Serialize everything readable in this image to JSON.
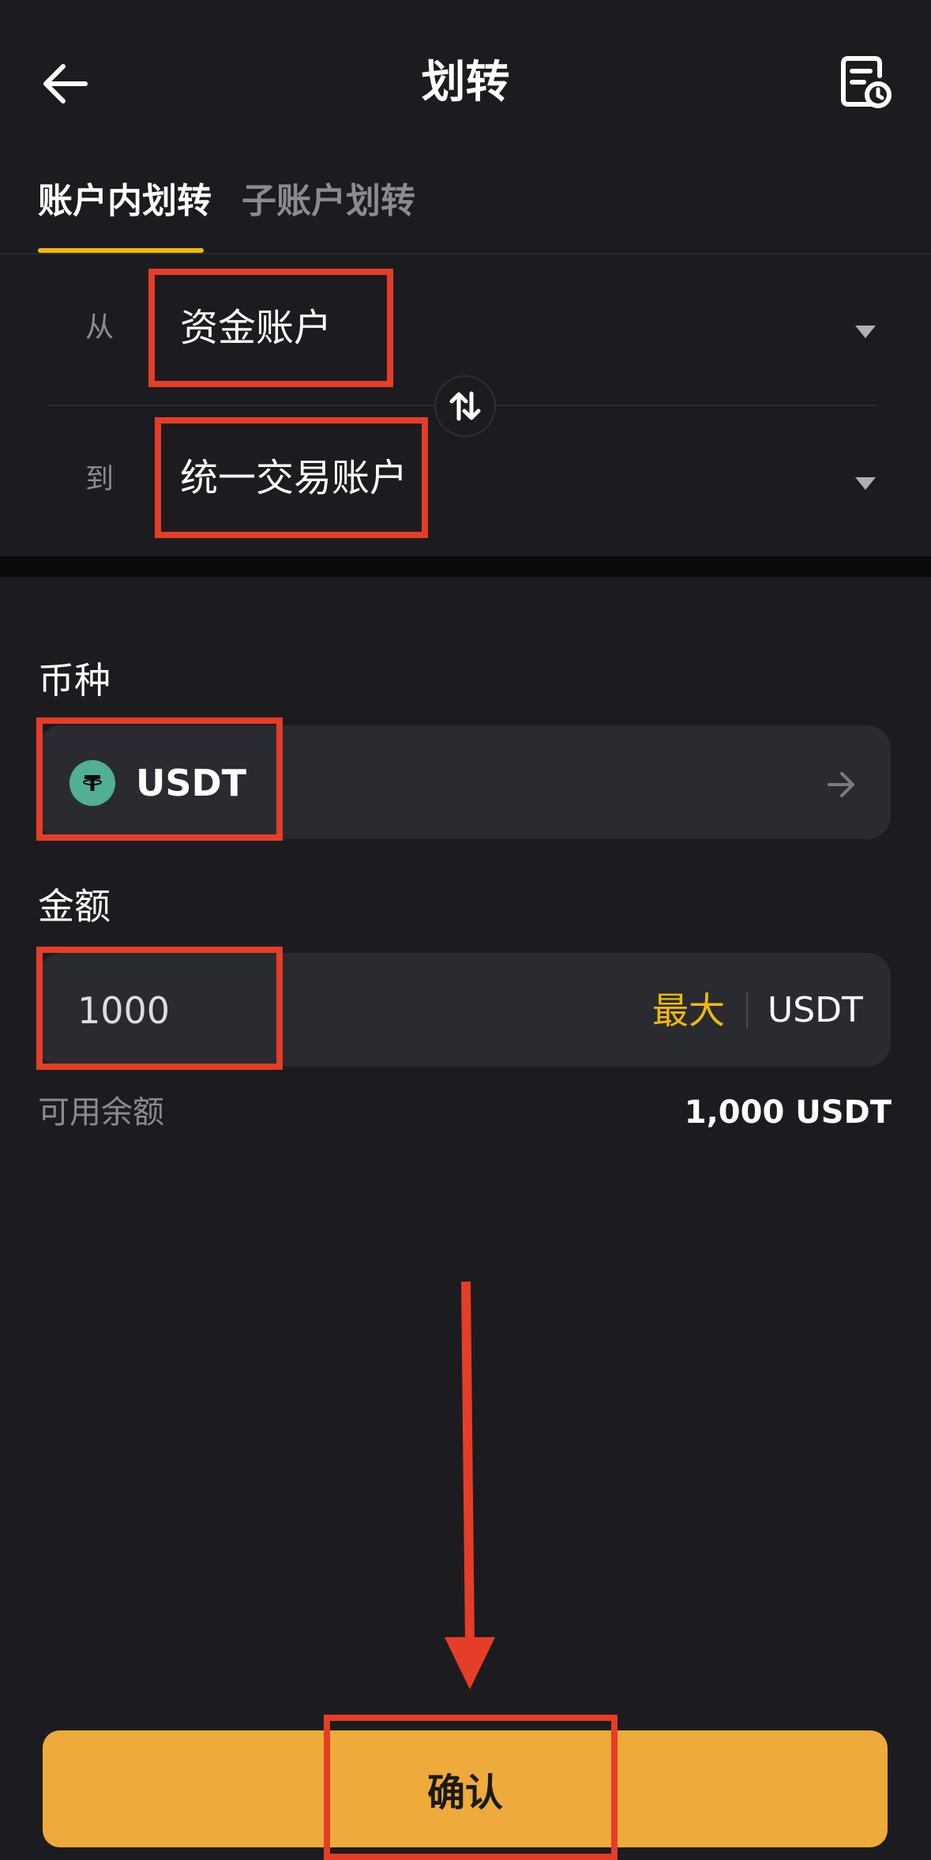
{
  "header": {
    "title": "划转",
    "back_icon": "arrow-left-icon",
    "history_icon": "record-history-icon"
  },
  "tabs": [
    {
      "label": "账户内划转",
      "active": true
    },
    {
      "label": "子账户划转",
      "active": false
    }
  ],
  "transfer": {
    "from_label": "从",
    "from_value": "资金账户",
    "to_label": "到",
    "to_value": "统一交易账户",
    "swap_icon": "swap-arrows-icon"
  },
  "coin": {
    "label": "币种",
    "name": "USDT",
    "icon": "tether-icon"
  },
  "amount": {
    "label": "金额",
    "value": "1000",
    "max_label": "最大",
    "unit": "USDT"
  },
  "balance": {
    "label": "可用余额",
    "value": "1,000 USDT"
  },
  "confirm_label": "确认",
  "colors": {
    "background": "#1c1c20",
    "accent": "#f0b90b",
    "button": "#eeaa3a",
    "highlight": "#e53d27",
    "coin": "#50af95"
  }
}
